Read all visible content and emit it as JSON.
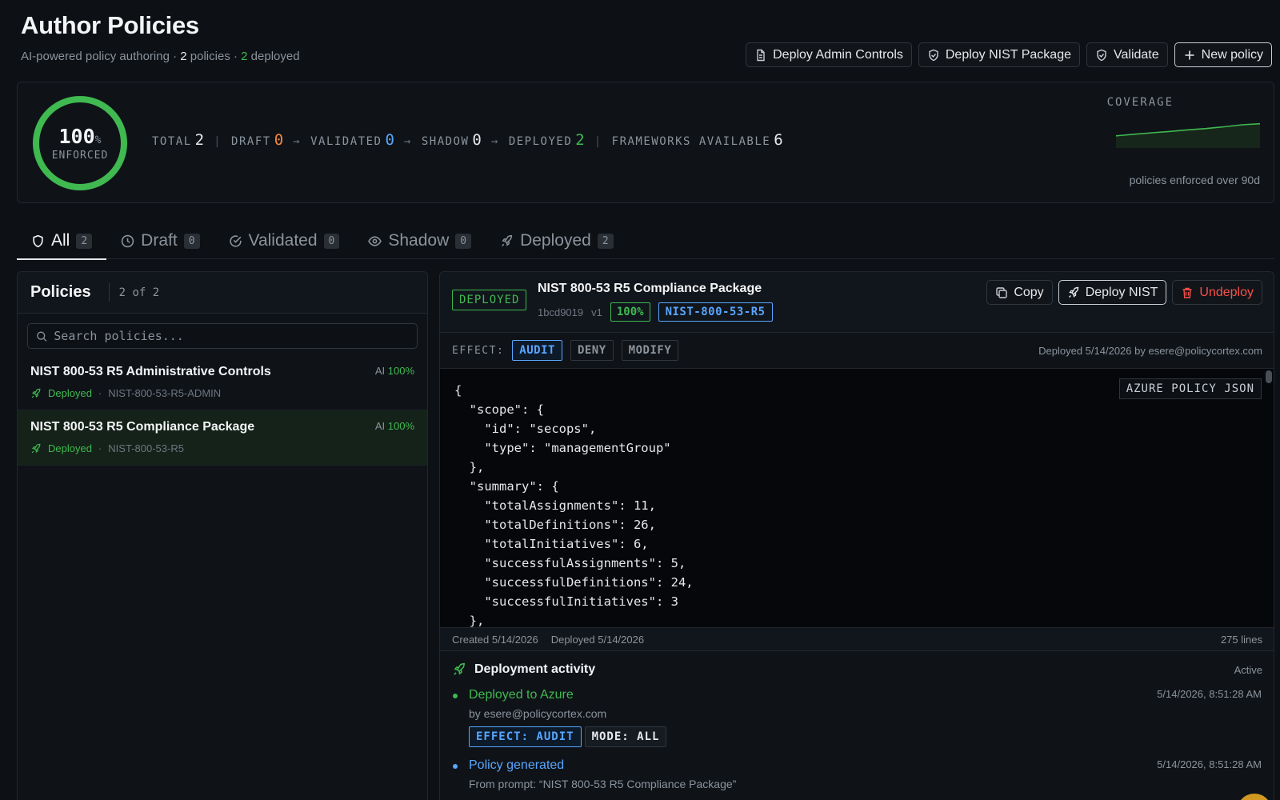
{
  "header": {
    "title": "Author Policies",
    "subtitle_prefix": "AI-powered policy authoring · ",
    "policy_count": "2",
    "policies_word": " policies · ",
    "deployed_count": "2",
    "deployed_word": " deployed",
    "actions": {
      "deploy_admin": "Deploy Admin Controls",
      "deploy_nist": "Deploy NIST Package",
      "validate": "Validate",
      "new_policy": "New policy"
    }
  },
  "stats": {
    "enforced_pct": "100",
    "pct_sign": "%",
    "enforced_label": "ENFORCED",
    "total_label": "TOTAL",
    "total": "2",
    "draft_label": "DRAFT",
    "draft": "0",
    "validated_label": "VALIDATED",
    "validated": "0",
    "shadow_label": "SHADOW",
    "shadow": "0",
    "deployed_label": "DEPLOYED",
    "deployed": "2",
    "frameworks_label": "FRAMEWORKS AVAILABLE",
    "frameworks": "6",
    "arrow": "→",
    "pipe": "|",
    "coverage_title": "COVERAGE",
    "coverage_caption": "policies enforced over 90d",
    "coverage_series": [
      40,
      48,
      55,
      62,
      70,
      76,
      85,
      95,
      100
    ]
  },
  "tabs": [
    {
      "label": "All",
      "count": "2"
    },
    {
      "label": "Draft",
      "count": "0"
    },
    {
      "label": "Validated",
      "count": "0"
    },
    {
      "label": "Shadow",
      "count": "0"
    },
    {
      "label": "Deployed",
      "count": "2"
    }
  ],
  "list": {
    "title": "Policies",
    "count": "2 of 2",
    "search_placeholder": "Search policies...",
    "items": [
      {
        "name": "NIST 800-53 R5 Administrative Controls",
        "status": "Deployed",
        "dot": "·",
        "code": "NIST-800-53-R5-ADMIN",
        "ai_label": "AI",
        "ai_pct": "100%"
      },
      {
        "name": "NIST 800-53 R5 Compliance Package",
        "status": "Deployed",
        "dot": "·",
        "code": "NIST-800-53-R5",
        "ai_label": "AI",
        "ai_pct": "100%"
      }
    ]
  },
  "detail": {
    "status": "DEPLOYED",
    "title": "NIST 800-53 R5 Compliance Package",
    "hash": "1bcd9019",
    "version": "v1",
    "pct": "100%",
    "framework": "NIST-800-53-R5",
    "actions": {
      "copy": "Copy",
      "deploy": "Deploy NIST",
      "undeploy": "Undeploy"
    },
    "effect_label": "EFFECT:",
    "effects": [
      "AUDIT",
      "DENY",
      "MODIFY"
    ],
    "deployed_by": "Deployed 5/14/2026 by esere@policycortex.com",
    "json_label": "AZURE POLICY JSON",
    "code": "{\n  \"scope\": {\n    \"id\": \"secops\",\n    \"type\": \"managementGroup\"\n  },\n  \"summary\": {\n    \"totalAssignments\": 11,\n    \"totalDefinitions\": 26,\n    \"totalInitiatives\": 6,\n    \"successfulAssignments\": 5,\n    \"successfulDefinitions\": 24,\n    \"successfulInitiatives\": 3\n  },",
    "created": "Created 5/14/2026",
    "deployed_date": "Deployed 5/14/2026",
    "lines": "275 lines",
    "activity": {
      "title": "Deployment activity",
      "status": "Active",
      "events": [
        {
          "title": "Deployed to Azure",
          "time": "5/14/2026, 8:51:28 AM",
          "by": "by esere@policycortex.com",
          "tags": [
            "EFFECT: AUDIT",
            "MODE: ALL"
          ]
        },
        {
          "title": "Policy generated",
          "time": "5/14/2026, 8:51:28 AM",
          "by": "From prompt: “NIST 800-53 R5 Compliance Package”"
        }
      ]
    }
  },
  "colors": {
    "green": "#3fb950",
    "blue": "#58a6ff",
    "orange": "#f0883e",
    "red": "#f85149"
  }
}
